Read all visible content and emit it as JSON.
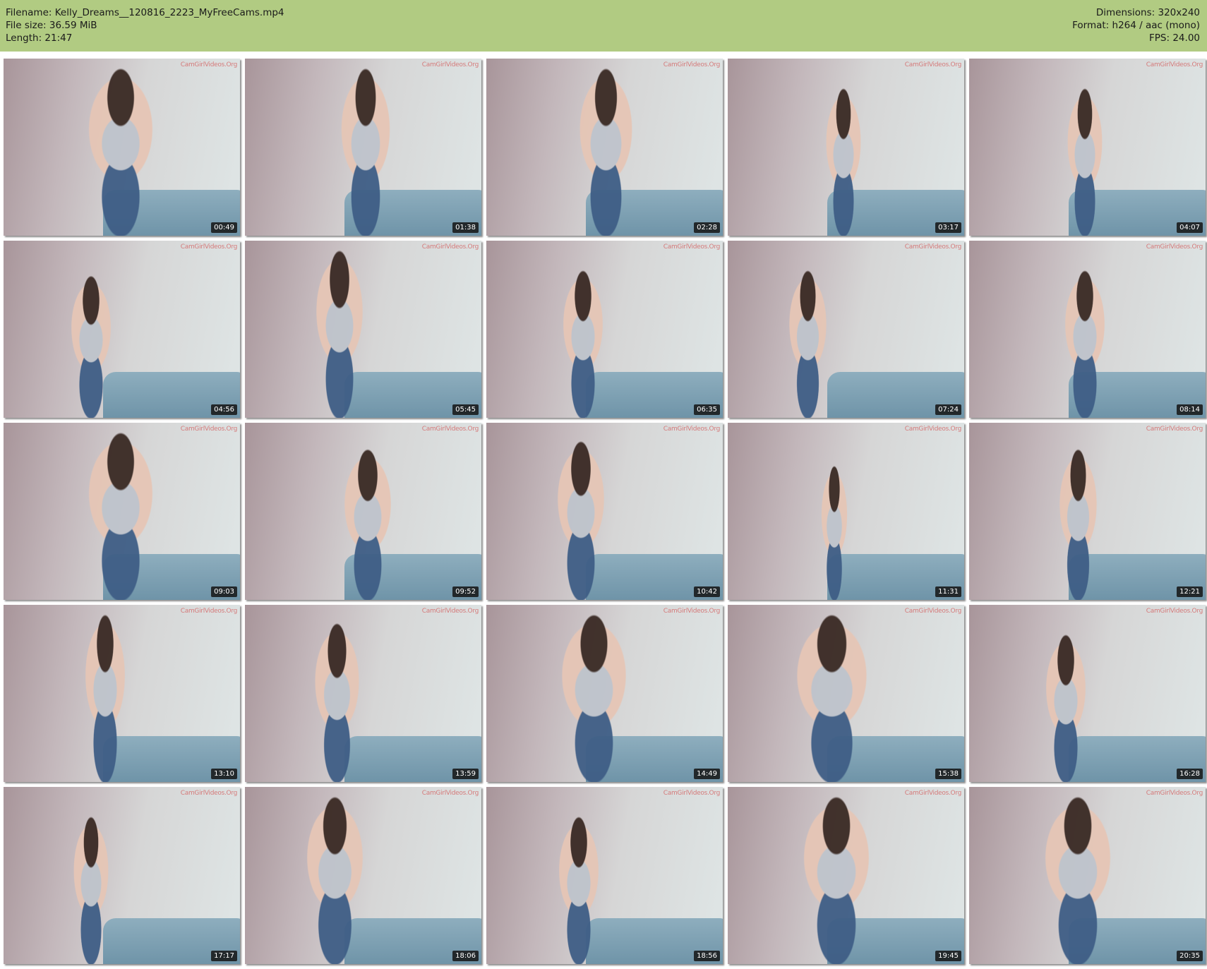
{
  "header": {
    "filename": "Filename: Kelly_Dreams__120816_2223_MyFreeCams.mp4",
    "filesize": "File size: 36.59 MiB",
    "length": "Length: 21:47",
    "dimensions": "Dimensions: 320x240",
    "format": "Format: h264 / aac (mono)",
    "fps": "FPS: 24.00"
  },
  "watermark": "CamGirlVideos.Org",
  "thumbnails": [
    {
      "time": "00:49"
    },
    {
      "time": "01:38"
    },
    {
      "time": "02:28"
    },
    {
      "time": "03:17"
    },
    {
      "time": "04:07"
    },
    {
      "time": "04:56"
    },
    {
      "time": "05:45"
    },
    {
      "time": "06:35"
    },
    {
      "time": "07:24"
    },
    {
      "time": "08:14"
    },
    {
      "time": "09:03"
    },
    {
      "time": "09:52"
    },
    {
      "time": "10:42"
    },
    {
      "time": "11:31"
    },
    {
      "time": "12:21"
    },
    {
      "time": "13:10"
    },
    {
      "time": "13:59"
    },
    {
      "time": "14:49"
    },
    {
      "time": "15:38"
    },
    {
      "time": "16:28"
    },
    {
      "time": "17:17"
    },
    {
      "time": "18:06"
    },
    {
      "time": "18:56"
    },
    {
      "time": "19:45"
    },
    {
      "time": "20:35"
    }
  ]
}
